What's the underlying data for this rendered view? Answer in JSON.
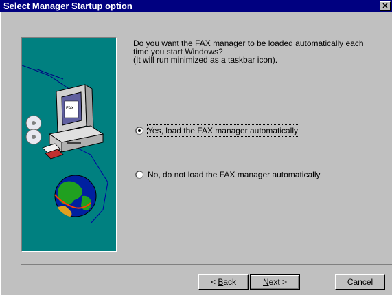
{
  "window": {
    "title": "Select Manager Startup option",
    "close_glyph": "✕"
  },
  "question": {
    "line1": "Do you want the FAX manager to be loaded automatically each",
    "line2": "time you start Windows?",
    "line3": "(It will run minimized as a taskbar icon)."
  },
  "options": [
    {
      "label": "Yes, load the FAX manager automatically",
      "selected": true
    },
    {
      "label": "No, do not load the FAX manager automatically",
      "selected": false
    }
  ],
  "buttons": {
    "back_prefix": "< ",
    "back_accel": "B",
    "back_rest": "ack",
    "next_accel": "N",
    "next_rest": "ext >",
    "cancel": "Cancel"
  },
  "colors": {
    "titlebar": "#000080",
    "panel": "#c0c0c0",
    "picture_bg": "#008080"
  },
  "icons": [
    "computer-icon",
    "cd-icon",
    "globe-icon",
    "close-icon"
  ]
}
